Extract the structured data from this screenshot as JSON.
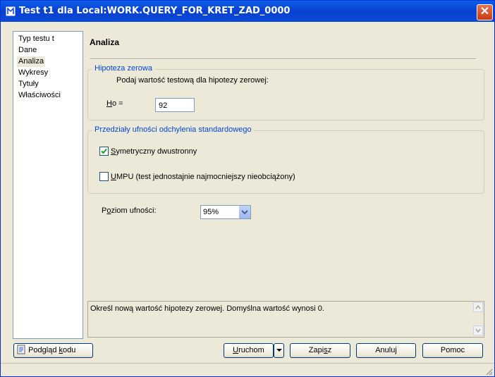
{
  "window": {
    "title": "Test t1 dla Local:WORK.QUERY_FOR_KRET_ZAD_0000"
  },
  "nav": {
    "items": [
      {
        "label": "Typ testu t"
      },
      {
        "label": "Dane"
      },
      {
        "label": "Analiza",
        "selected": true
      },
      {
        "label": "Wykresy"
      },
      {
        "label": "Tytuły"
      },
      {
        "label": "Właściwości"
      }
    ]
  },
  "main": {
    "heading": "Analiza",
    "hypothesis": {
      "title": "Hipoteza zerowa",
      "prompt": "Podaj wartość testową dla hipotezy zerowej:",
      "ho_label_key": "H",
      "ho_label_rest": "o =",
      "ho_value": "92"
    },
    "intervals": {
      "title": "Przedziały ufności odchylenia standardowego",
      "symmetric_key": "S",
      "symmetric_rest": "ymetryczny dwustronny",
      "symmetric_checked": true,
      "umpu_key": "U",
      "umpu_rest": "MPU (test jednostajnie najmocniejszy nieobciążony)",
      "umpu_checked": false
    },
    "confidence": {
      "label_pre": "P",
      "label_key": "o",
      "label_rest": "ziom ufności:",
      "value": "95%"
    },
    "help_text": "Określ nową wartość hipotezy zerowej. Domyślna wartość wynosi 0."
  },
  "footer": {
    "preview_pre": "Podgląd ",
    "preview_key": "k",
    "preview_rest": "odu",
    "run_key": "U",
    "run_rest": "ruchom",
    "save_pre": "Zapi",
    "save_key": "s",
    "save_rest": "z",
    "cancel": "Anuluj",
    "help": "Pomoc"
  },
  "colors": {
    "titlebar": "#0a4bd6",
    "group_title": "#0046d5",
    "face": "#ece9d8"
  }
}
